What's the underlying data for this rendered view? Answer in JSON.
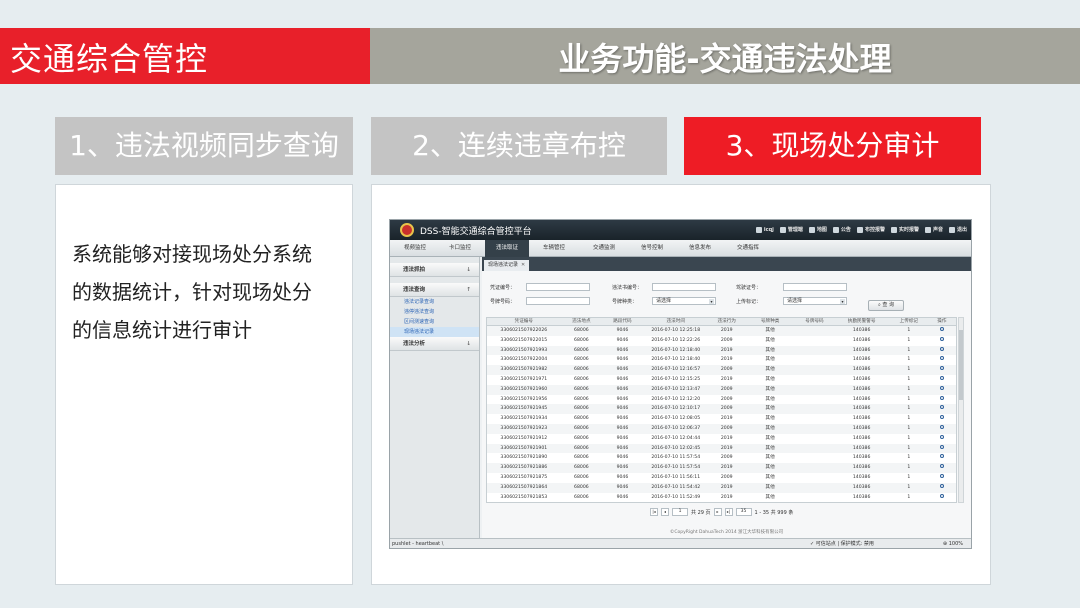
{
  "header": {
    "section_title": "交通综合管控",
    "page_title": "业务功能-交通违法处理"
  },
  "steps": [
    {
      "label": "1、违法视频同步查询"
    },
    {
      "label": "2、连续违章布控"
    },
    {
      "label": "3、现场处分审计"
    }
  ],
  "description": "系统能够对接现场处分系统的数据统计，针对现场处分的信息统计进行审计",
  "colors": {
    "header_red": "#e8202a",
    "header_grey": "#a5a59c",
    "step_inactive": "#c4c4c4",
    "step_active": "#ee1c25"
  },
  "app": {
    "title": "DSS-智能交通综合管控平台",
    "toolbar": [
      "icqj",
      "管理端",
      "地图",
      "公告",
      "布控报警",
      "实时报警",
      "声音",
      "退出"
    ],
    "menu": [
      "视频监控",
      "卡口监控",
      "违法取证",
      "车辆管控",
      "交通监测",
      "信号控制",
      "信息发布",
      "交通指挥"
    ],
    "active_menu": "违法取证",
    "sidebar": {
      "group1": "违法抓拍",
      "group2": "违法查询",
      "items": [
        "违法记录查询",
        "违停违法查询",
        "区间测速查询",
        "现场违法记录"
      ],
      "group3": "违法分析"
    },
    "tab_label": "现场违法记录",
    "form": {
      "cert_no_label": "凭证编号：",
      "notice_no_label": "违法书编号：",
      "plate_label": "驾驶证号：",
      "plate_no_label": "号牌号码：",
      "plate_type_label": "号牌种类：",
      "plate_type_value": "请选择",
      "upload_label": "上传标记：",
      "upload_value": "请选择",
      "query_button": "查 询"
    },
    "columns": [
      "凭证编号",
      "违法地点",
      "路段代码",
      "违法时间",
      "违法行为",
      "号牌种类",
      "号牌号码",
      "执勤民警警号",
      "上传标记",
      "操作"
    ],
    "rows": [
      [
        "3306021507922026",
        "68006",
        "9046",
        "2016-07-10 12:25:18",
        "2019",
        "其他",
        "",
        "140386",
        "1"
      ],
      [
        "3306021507922015",
        "68006",
        "9046",
        "2016-07-10 12:22:26",
        "2009",
        "其他",
        "",
        "140386",
        "1"
      ],
      [
        "3306021507921993",
        "68006",
        "9046",
        "2016-07-10 12:18:40",
        "2019",
        "其他",
        "",
        "140386",
        "1"
      ],
      [
        "3306021507922004",
        "68006",
        "9046",
        "2016-07-10 12:18:40",
        "2019",
        "其他",
        "",
        "140386",
        "1"
      ],
      [
        "3306021507921982",
        "68006",
        "9046",
        "2016-07-10 12:16:57",
        "2009",
        "其他",
        "",
        "140386",
        "1"
      ],
      [
        "3306021507921971",
        "68006",
        "9046",
        "2016-07-10 12:15:25",
        "2019",
        "其他",
        "",
        "140386",
        "1"
      ],
      [
        "3306021507921960",
        "68006",
        "9046",
        "2016-07-10 12:13:47",
        "2009",
        "其他",
        "",
        "140386",
        "1"
      ],
      [
        "3306021507921956",
        "68006",
        "9046",
        "2016-07-10 12:12:20",
        "2009",
        "其他",
        "",
        "140386",
        "1"
      ],
      [
        "3306021507921945",
        "68006",
        "9046",
        "2016-07-10 12:10:17",
        "2009",
        "其他",
        "",
        "140386",
        "1"
      ],
      [
        "3306021507921934",
        "68006",
        "9046",
        "2016-07-10 12:08:05",
        "2019",
        "其他",
        "",
        "140386",
        "1"
      ],
      [
        "3306021507921923",
        "68006",
        "9046",
        "2016-07-10 12:06:37",
        "2009",
        "其他",
        "",
        "140386",
        "1"
      ],
      [
        "3306021507921912",
        "68006",
        "9046",
        "2016-07-10 12:04:44",
        "2019",
        "其他",
        "",
        "140386",
        "1"
      ],
      [
        "3306021507921901",
        "68006",
        "9046",
        "2016-07-10 12:02:45",
        "2019",
        "其他",
        "",
        "140386",
        "1"
      ],
      [
        "3306021507921890",
        "68006",
        "9046",
        "2016-07-10 11:57:54",
        "2009",
        "其他",
        "",
        "140386",
        "1"
      ],
      [
        "3306021507921886",
        "68006",
        "9046",
        "2016-07-10 11:57:54",
        "2019",
        "其他",
        "",
        "140386",
        "1"
      ],
      [
        "3306021507921875",
        "68006",
        "9046",
        "2016-07-10 11:56:11",
        "2009",
        "其他",
        "",
        "140386",
        "1"
      ],
      [
        "3306021507921864",
        "68006",
        "9046",
        "2016-07-10 11:54:42",
        "2019",
        "其他",
        "",
        "140386",
        "1"
      ],
      [
        "3306021507921853",
        "68006",
        "9046",
        "2016-07-10 11:52:49",
        "2019",
        "其他",
        "",
        "140386",
        "1"
      ]
    ],
    "pager": {
      "page_input": "1",
      "total_pages": "共 29 页",
      "page_size": "35",
      "range": "1 - 35  共 999 条"
    },
    "copyright": "©CopyRight DahuaTech 2014 浙江大华科技有限公司",
    "status_left": "pushlet - heartbeat \\",
    "status_mid": "可信站点 | 保护模式: 禁用",
    "status_zoom": "100%"
  }
}
